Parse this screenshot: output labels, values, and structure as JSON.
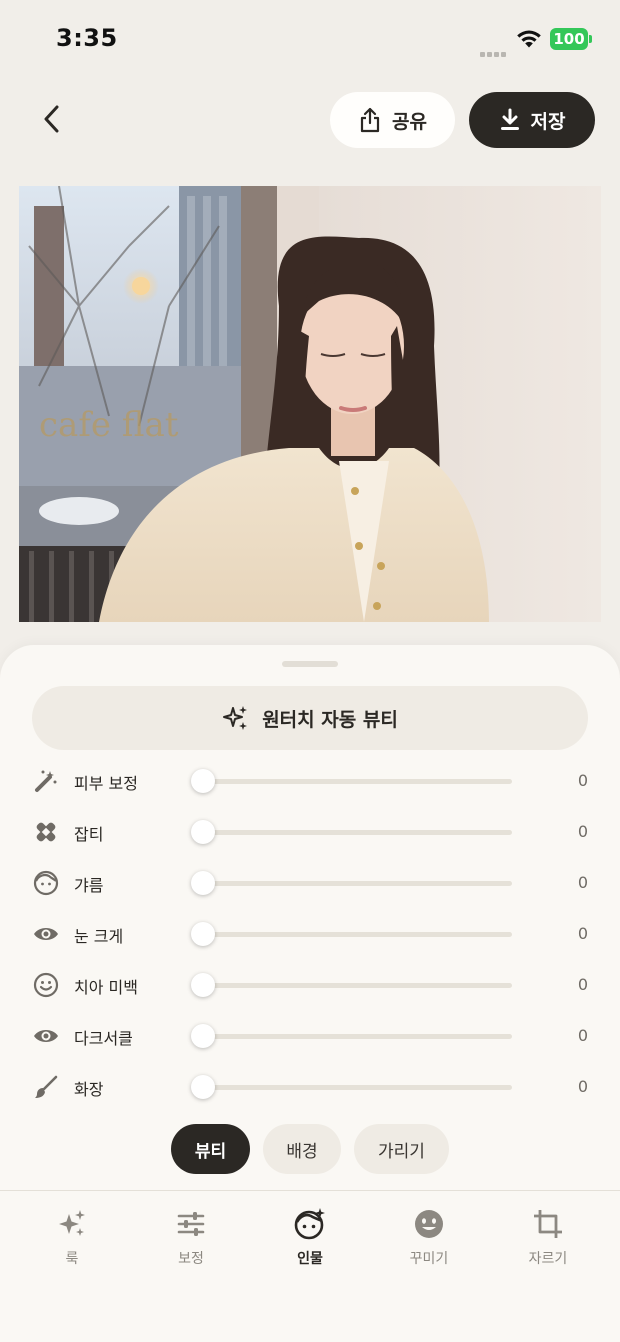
{
  "status_bar": {
    "time": "3:35",
    "battery": "100"
  },
  "header": {
    "share_label": "공유",
    "save_label": "저장"
  },
  "colors": {
    "accent_dark": "#2b2824",
    "sheet_bg": "#faf8f4",
    "battery_green": "#34c759"
  },
  "beauty": {
    "auto_label": "원터치 자동 뷰티",
    "sliders": [
      {
        "label": "피부 보정",
        "icon": "magic-wand-icon",
        "value": "0"
      },
      {
        "label": "잡티",
        "icon": "bandage-icon",
        "value": "0"
      },
      {
        "label": "갸름",
        "icon": "face-icon",
        "value": "0"
      },
      {
        "label": "눈 크게",
        "icon": "eye-icon",
        "value": "0"
      },
      {
        "label": "치아 미백",
        "icon": "smile-icon",
        "value": "0"
      },
      {
        "label": "다크서클",
        "icon": "eye-icon",
        "value": "0"
      },
      {
        "label": "화장",
        "icon": "brush-icon",
        "value": "0"
      }
    ]
  },
  "subtabs": [
    {
      "label": "뷰티",
      "active": true
    },
    {
      "label": "배경",
      "active": false
    },
    {
      "label": "가리기",
      "active": false
    }
  ],
  "bottom_nav": [
    {
      "label": "룩",
      "icon": "sparkles-icon",
      "active": false
    },
    {
      "label": "보정",
      "icon": "sliders-icon",
      "active": false
    },
    {
      "label": "인물",
      "icon": "face-sparkle-icon",
      "active": true
    },
    {
      "label": "꾸미기",
      "icon": "emoji-icon",
      "active": false
    },
    {
      "label": "자르기",
      "icon": "crop-icon",
      "active": false
    }
  ]
}
